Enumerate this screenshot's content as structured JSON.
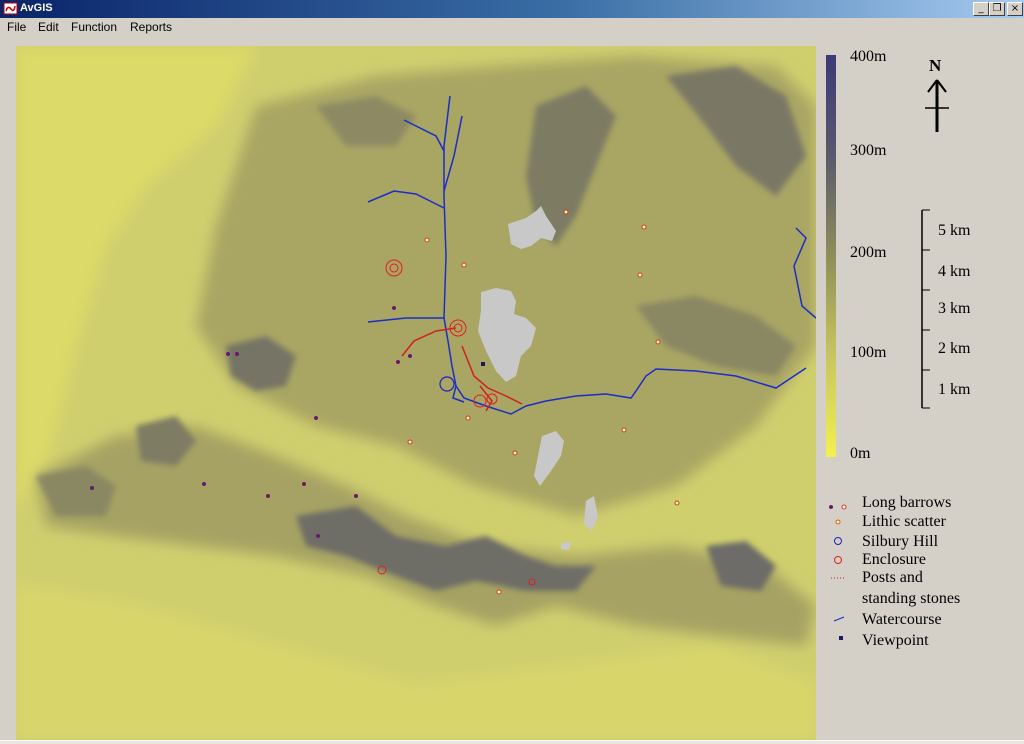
{
  "window": {
    "title": "AvGIS",
    "controls": {
      "minimize": "_",
      "restore": "❐",
      "close": "×"
    }
  },
  "menu": {
    "items": [
      "File",
      "Edit",
      "Function",
      "Reports"
    ]
  },
  "elevation_scale": {
    "labels": [
      "400m",
      "300m",
      "200m",
      "100m",
      "0m"
    ],
    "gradient_top": "#3a3a78",
    "gradient_mid": "#8e8e5a",
    "gradient_bottom": "#f4f050"
  },
  "north_arrow": {
    "label": "N"
  },
  "distance_scale": {
    "labels": [
      "5 km",
      "4 km",
      "3 km",
      "2 km",
      "1 km"
    ]
  },
  "legend": {
    "long_barrows": "Long barrows",
    "lithic_scatter": "Lithic scatter",
    "silbury_hill": "Silbury Hill",
    "enclosure": "Enclosure",
    "posts_line1": "Posts and",
    "posts_line2": "standing stones",
    "watercourse": "Watercourse",
    "viewpoint": "Viewpoint"
  },
  "colors": {
    "long_barrow": "#6a1a6a",
    "lithic_scatter": "#e06000",
    "silbury_hill": "#2020c0",
    "enclosure": "#e02020",
    "posts": "#d02020",
    "watercourse": "#1a2ec8",
    "viewpoint": "#1a1a60",
    "settlement": "#c8c8c8"
  }
}
